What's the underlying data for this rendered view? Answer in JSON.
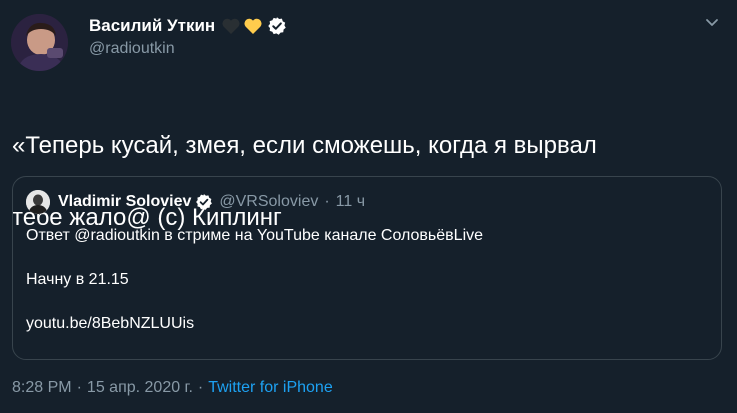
{
  "author": {
    "display_name": "Василий Уткин",
    "handle": "@radioutkin",
    "emoji_icons": [
      "black-heart-icon",
      "yellow-heart-icon"
    ],
    "verified_icon": "verified-badge-icon"
  },
  "tweet": {
    "text_line1": "«Теперь кусай, змея, если сможешь, когда я вырвал",
    "text_line2": "тебе жало@ (с) Киплинг"
  },
  "quoted": {
    "display_name": "Vladimir Soloviev",
    "handle": "@VRSoloviev",
    "separator": "·",
    "time": "11 ч",
    "line1": "Ответ @radioutkin в стриме на YouTube канале СоловьёвLive",
    "line2": "Начну в 21.15",
    "line3": "youtu.be/8BebNZLUUis"
  },
  "meta": {
    "time": "8:28 PM",
    "sep1": "·",
    "date": "15 апр. 2020 г.",
    "sep2": "·",
    "source": "Twitter for iPhone"
  },
  "colors": {
    "background": "#15202b",
    "text": "#ffffff",
    "secondary": "#8899a6",
    "accent": "#1da1f2",
    "border": "#38444d"
  }
}
